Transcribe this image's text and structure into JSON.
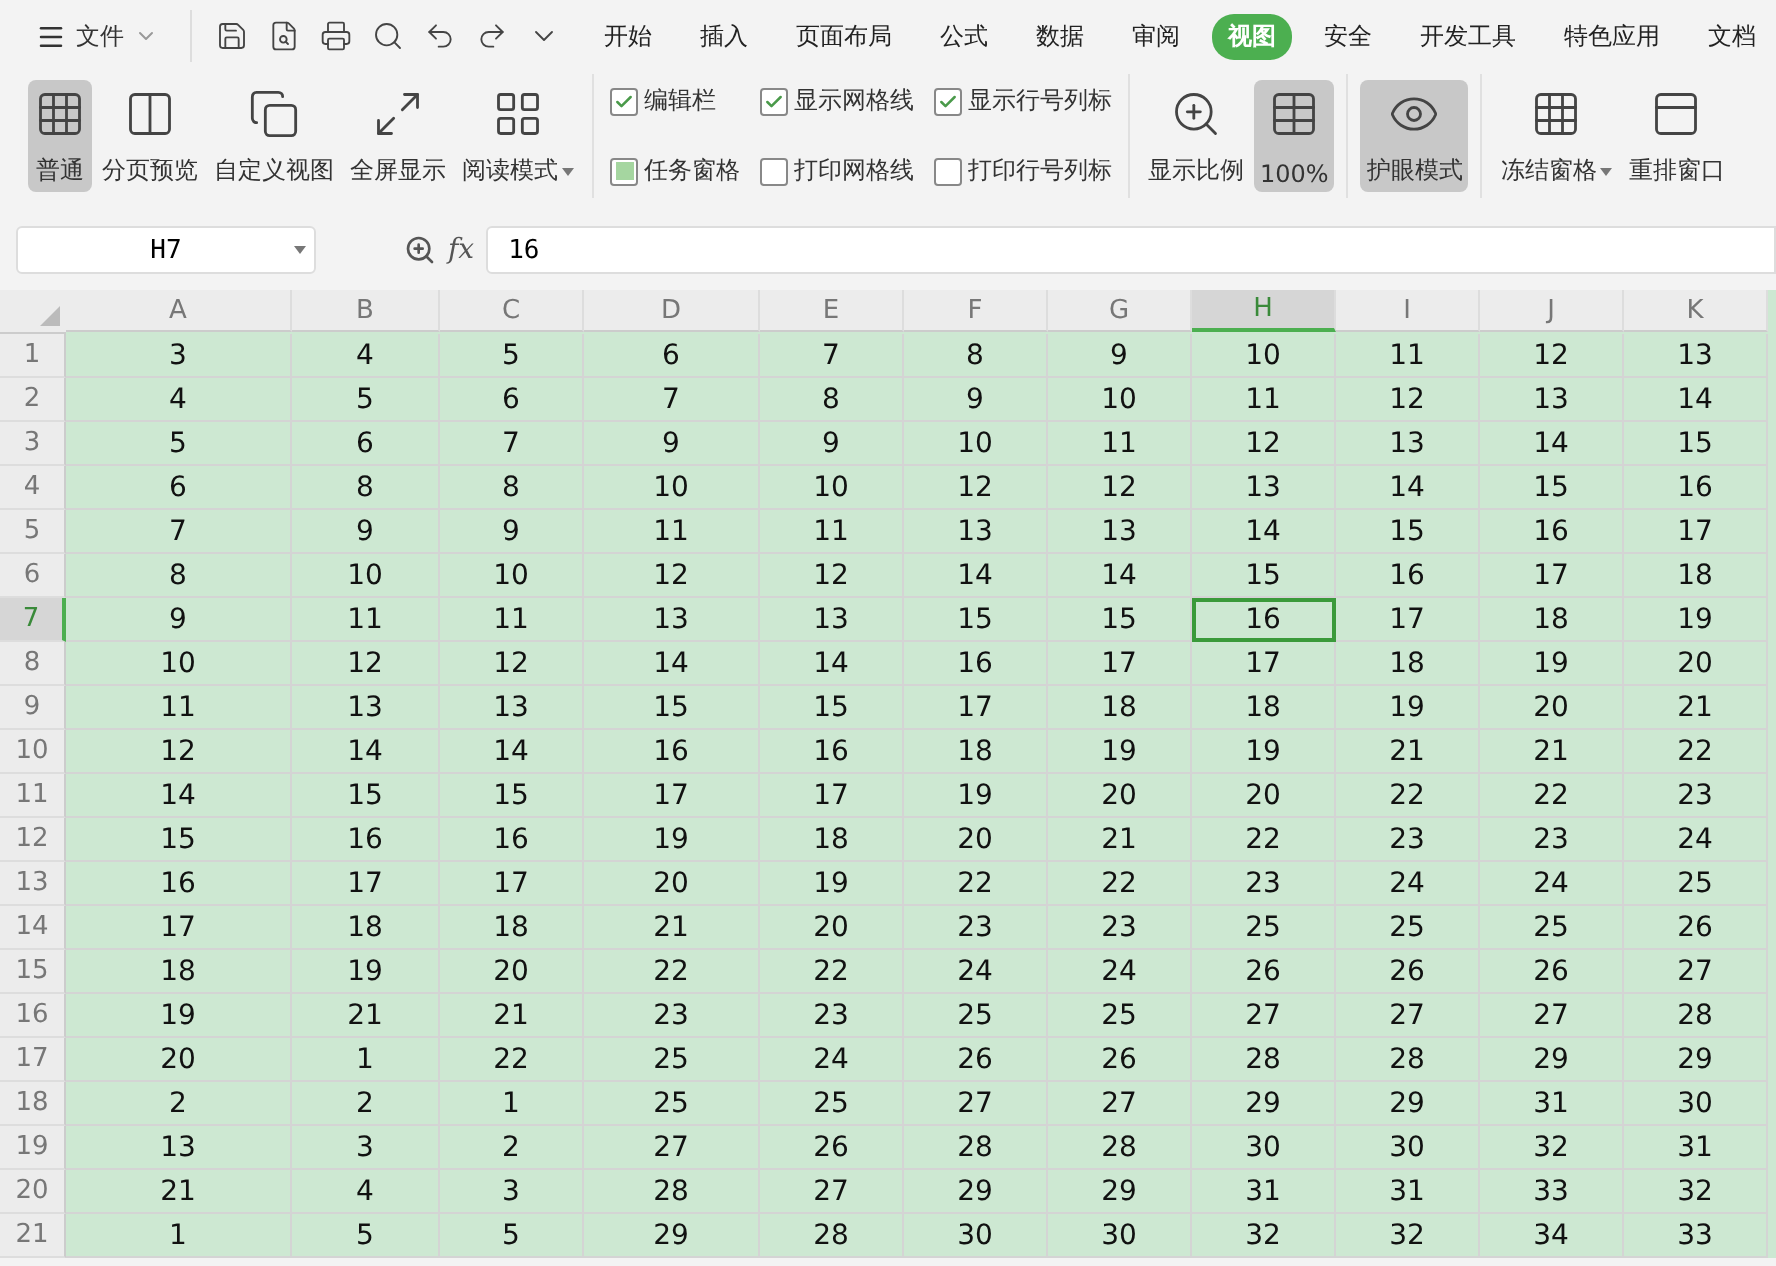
{
  "menu": {
    "label": "文件"
  },
  "tabs": [
    {
      "label": "开始",
      "selected": false
    },
    {
      "label": "插入",
      "selected": false
    },
    {
      "label": "页面布局",
      "selected": false
    },
    {
      "label": "公式",
      "selected": false
    },
    {
      "label": "数据",
      "selected": false
    },
    {
      "label": "审阅",
      "selected": false
    },
    {
      "label": "视图",
      "selected": true
    },
    {
      "label": "安全",
      "selected": false
    },
    {
      "label": "开发工具",
      "selected": false
    },
    {
      "label": "特色应用",
      "selected": false
    },
    {
      "label": "文档",
      "selected": false
    }
  ],
  "view_buttons": [
    {
      "label": "普通",
      "selected": true,
      "dropdown": false
    },
    {
      "label": "分页预览",
      "selected": false,
      "dropdown": false
    },
    {
      "label": "自定义视图",
      "selected": false,
      "dropdown": false
    },
    {
      "label": "全屏显示",
      "selected": false,
      "dropdown": false
    },
    {
      "label": "阅读模式",
      "selected": false,
      "dropdown": true
    }
  ],
  "checkboxes": [
    {
      "label": "编辑栏",
      "checked": true,
      "kind": "tick"
    },
    {
      "label": "任务窗格",
      "checked": true,
      "kind": "fill"
    },
    {
      "label": "显示网格线",
      "checked": true,
      "kind": "tick"
    },
    {
      "label": "打印网格线",
      "checked": false
    },
    {
      "label": "显示行号列标",
      "checked": true,
      "kind": "tick"
    },
    {
      "label": "打印行号列标",
      "checked": false
    }
  ],
  "zoom_buttons": [
    {
      "label": "显示比例",
      "selected": false,
      "dropdown": false
    },
    {
      "label": "100%",
      "selected": true,
      "dropdown": false
    }
  ],
  "eye_buttons": [
    {
      "label": "护眼模式",
      "selected": true,
      "dropdown": false
    }
  ],
  "window_buttons": [
    {
      "label": "冻结窗格",
      "selected": false,
      "dropdown": true
    },
    {
      "label": "重排窗口",
      "selected": false,
      "dropdown": false
    }
  ],
  "formula_bar": {
    "name_box": "H7",
    "fx": "fx",
    "value": "16"
  },
  "columns": [
    {
      "label": "A",
      "selected": false
    },
    {
      "label": "B",
      "selected": false
    },
    {
      "label": "C",
      "selected": false
    },
    {
      "label": "D",
      "selected": false
    },
    {
      "label": "E",
      "selected": false
    },
    {
      "label": "F",
      "selected": false
    },
    {
      "label": "G",
      "selected": false
    },
    {
      "label": "H",
      "selected": true
    },
    {
      "label": "I",
      "selected": false
    },
    {
      "label": "J",
      "selected": false
    },
    {
      "label": "K",
      "selected": false
    }
  ],
  "rows": [
    {
      "number": "1",
      "selected": false,
      "cells": [
        "3",
        "4",
        "5",
        "6",
        "7",
        "8",
        "9",
        "10",
        "11",
        "12",
        "13"
      ]
    },
    {
      "number": "2",
      "selected": false,
      "cells": [
        "4",
        "5",
        "6",
        "7",
        "8",
        "9",
        "10",
        "11",
        "12",
        "13",
        "14"
      ]
    },
    {
      "number": "3",
      "selected": false,
      "cells": [
        "5",
        "6",
        "7",
        "9",
        "9",
        "10",
        "11",
        "12",
        "13",
        "14",
        "15"
      ]
    },
    {
      "number": "4",
      "selected": false,
      "cells": [
        "6",
        "8",
        "8",
        "10",
        "10",
        "12",
        "12",
        "13",
        "14",
        "15",
        "16"
      ]
    },
    {
      "number": "5",
      "selected": false,
      "cells": [
        "7",
        "9",
        "9",
        "11",
        "11",
        "13",
        "13",
        "14",
        "15",
        "16",
        "17"
      ]
    },
    {
      "number": "6",
      "selected": false,
      "cells": [
        "8",
        "10",
        "10",
        "12",
        "12",
        "14",
        "14",
        "15",
        "16",
        "17",
        "18"
      ]
    },
    {
      "number": "7",
      "selected": true,
      "cells": [
        "9",
        "11",
        "11",
        "13",
        "13",
        "15",
        "15",
        "16",
        "17",
        "18",
        "19"
      ]
    },
    {
      "number": "8",
      "selected": false,
      "cells": [
        "10",
        "12",
        "12",
        "14",
        "14",
        "16",
        "17",
        "17",
        "18",
        "19",
        "20"
      ]
    },
    {
      "number": "9",
      "selected": false,
      "cells": [
        "11",
        "13",
        "13",
        "15",
        "15",
        "17",
        "18",
        "18",
        "19",
        "20",
        "21"
      ]
    },
    {
      "number": "10",
      "selected": false,
      "cells": [
        "12",
        "14",
        "14",
        "16",
        "16",
        "18",
        "19",
        "19",
        "21",
        "21",
        "22"
      ]
    },
    {
      "number": "11",
      "selected": false,
      "cells": [
        "14",
        "15",
        "15",
        "17",
        "17",
        "19",
        "20",
        "20",
        "22",
        "22",
        "23"
      ]
    },
    {
      "number": "12",
      "selected": false,
      "cells": [
        "15",
        "16",
        "16",
        "19",
        "18",
        "20",
        "21",
        "22",
        "23",
        "23",
        "24"
      ]
    },
    {
      "number": "13",
      "selected": false,
      "cells": [
        "16",
        "17",
        "17",
        "20",
        "19",
        "22",
        "22",
        "23",
        "24",
        "24",
        "25"
      ]
    },
    {
      "number": "14",
      "selected": false,
      "cells": [
        "17",
        "18",
        "18",
        "21",
        "20",
        "23",
        "23",
        "25",
        "25",
        "25",
        "26"
      ]
    },
    {
      "number": "15",
      "selected": false,
      "cells": [
        "18",
        "19",
        "20",
        "22",
        "22",
        "24",
        "24",
        "26",
        "26",
        "26",
        "27"
      ]
    },
    {
      "number": "16",
      "selected": false,
      "cells": [
        "19",
        "21",
        "21",
        "23",
        "23",
        "25",
        "25",
        "27",
        "27",
        "27",
        "28"
      ]
    },
    {
      "number": "17",
      "selected": false,
      "cells": [
        "20",
        "1",
        "22",
        "25",
        "24",
        "26",
        "26",
        "28",
        "28",
        "29",
        "29"
      ]
    },
    {
      "number": "18",
      "selected": false,
      "cells": [
        "2",
        "2",
        "1",
        "25",
        "25",
        "27",
        "27",
        "29",
        "29",
        "31",
        "30"
      ]
    },
    {
      "number": "19",
      "selected": false,
      "cells": [
        "13",
        "3",
        "2",
        "27",
        "26",
        "28",
        "28",
        "30",
        "30",
        "32",
        "31"
      ]
    },
    {
      "number": "20",
      "selected": false,
      "cells": [
        "21",
        "4",
        "3",
        "28",
        "27",
        "29",
        "29",
        "31",
        "31",
        "33",
        "32"
      ]
    },
    {
      "number": "21",
      "selected": false,
      "cells": [
        "1",
        "5",
        "5",
        "29",
        "28",
        "30",
        "30",
        "32",
        "32",
        "34",
        "33"
      ]
    }
  ]
}
